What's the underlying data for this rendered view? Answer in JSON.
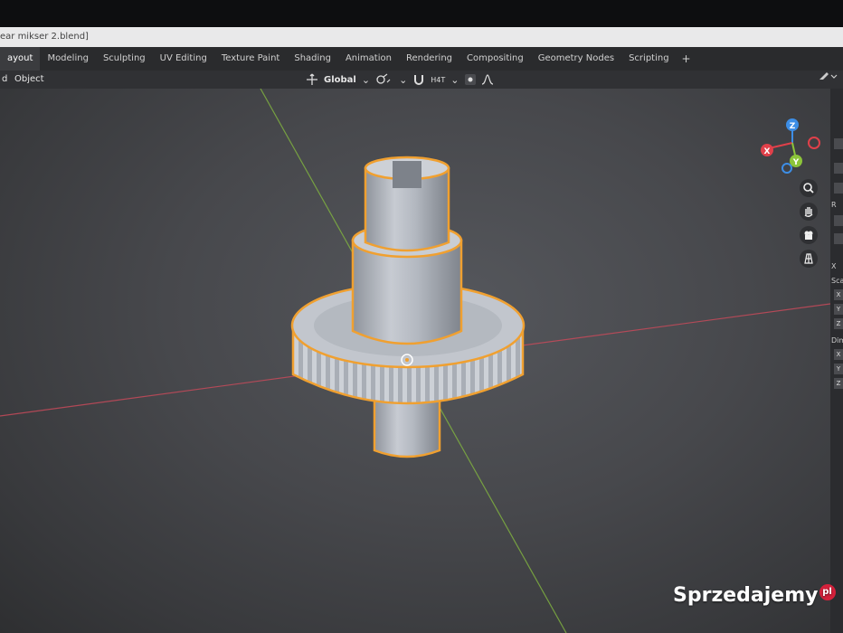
{
  "window": {
    "title": "ear mikser 2.blend]"
  },
  "workspace_tabs": [
    {
      "label": "ayout",
      "active": true
    },
    {
      "label": "Modeling"
    },
    {
      "label": "Sculpting"
    },
    {
      "label": "UV Editing"
    },
    {
      "label": "Texture Paint"
    },
    {
      "label": "Shading"
    },
    {
      "label": "Animation"
    },
    {
      "label": "Rendering"
    },
    {
      "label": "Compositing"
    },
    {
      "label": "Geometry Nodes"
    },
    {
      "label": "Scripting"
    }
  ],
  "add_tab_label": "+",
  "header": {
    "mode_label": "d",
    "object_menu": "Object",
    "transform_orientation": "Global",
    "snap_label": "H4T"
  },
  "gizmo": {
    "z": "Z",
    "x": "X",
    "y": "Y"
  },
  "n_panel": {
    "rotation_label": "R",
    "x_label": "X",
    "scale_label": "Sca",
    "scale_x": "X",
    "scale_y": "Y",
    "scale_z": "Z",
    "dimensions_label": "Dim",
    "dim_x": "X",
    "dim_y": "Y",
    "dim_z": "Z"
  },
  "watermark": {
    "text": "Sprzedajemy",
    "suffix": "pl"
  },
  "colors": {
    "selection_outline": "#f0a030",
    "x_axis": "#c64a5a",
    "y_axis": "#7fb040",
    "gizmo_x": "#e0404a",
    "gizmo_y": "#8cc43a",
    "gizmo_z": "#3d8ee6"
  }
}
